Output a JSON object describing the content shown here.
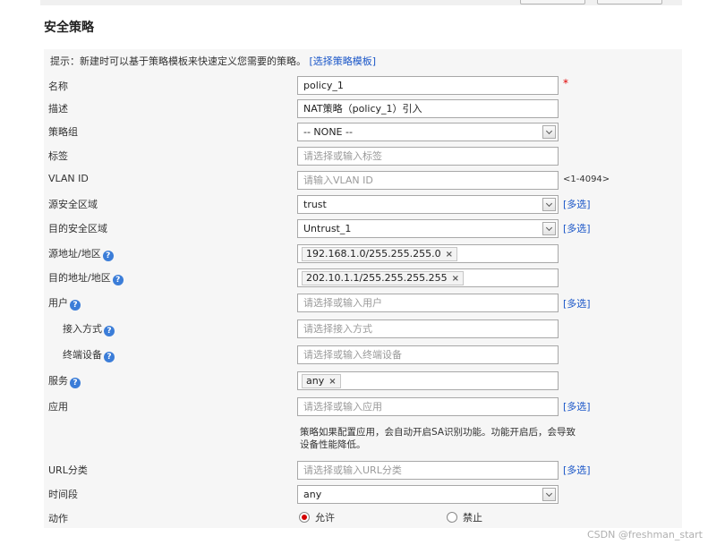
{
  "page": {
    "title": "安全策略",
    "hint_text": "提示：新建时可以基于策略模板来快速定义您需要的策略。",
    "hint_link": "[选择策略模板]"
  },
  "form": {
    "name": {
      "label": "名称",
      "value": "policy_1",
      "required_mark": "*"
    },
    "description": {
      "label": "描述",
      "value": "NAT策略（policy_1）引入"
    },
    "policy_group": {
      "label": "策略组",
      "value": "-- NONE --"
    },
    "tag": {
      "label": "标签",
      "placeholder": "请选择或输入标签"
    },
    "vlan": {
      "label": "VLAN ID",
      "placeholder": "请输入VLAN ID",
      "range": "<1-4094>"
    },
    "src_zone": {
      "label": "源安全区域",
      "value": "trust",
      "multi": "[多选]"
    },
    "dst_zone": {
      "label": "目的安全区域",
      "value": "Untrust_1",
      "multi": "[多选]"
    },
    "src_addr": {
      "label": "源地址/地区",
      "tag": "192.168.1.0/255.255.255.0",
      "tag_x": "×"
    },
    "dst_addr": {
      "label": "目的地址/地区",
      "tag": "202.10.1.1/255.255.255.255",
      "tag_x": "×"
    },
    "user": {
      "label": "用户",
      "placeholder": "请选择或输入用户",
      "multi": "[多选]"
    },
    "access_mode": {
      "label": "接入方式",
      "placeholder": "请选择接入方式"
    },
    "terminal": {
      "label": "终端设备",
      "placeholder": "请选择或输入终端设备"
    },
    "service": {
      "label": "服务",
      "tag": "any",
      "tag_x": "×"
    },
    "app": {
      "label": "应用",
      "placeholder": "请选择或输入应用",
      "multi": "[多选]"
    },
    "app_note": "策略如果配置应用，会自动开启SA识别功能。功能开启后，会导致设备性能降低。",
    "url": {
      "label": "URL分类",
      "placeholder": "请选择或输入URL分类",
      "multi": "[多选]"
    },
    "schedule": {
      "label": "时间段",
      "value": "any"
    },
    "action": {
      "label": "动作",
      "permit": "允许",
      "deny": "禁止",
      "selected": "允许"
    }
  },
  "help_glyph": "?",
  "watermark": "CSDN @freshman_start"
}
